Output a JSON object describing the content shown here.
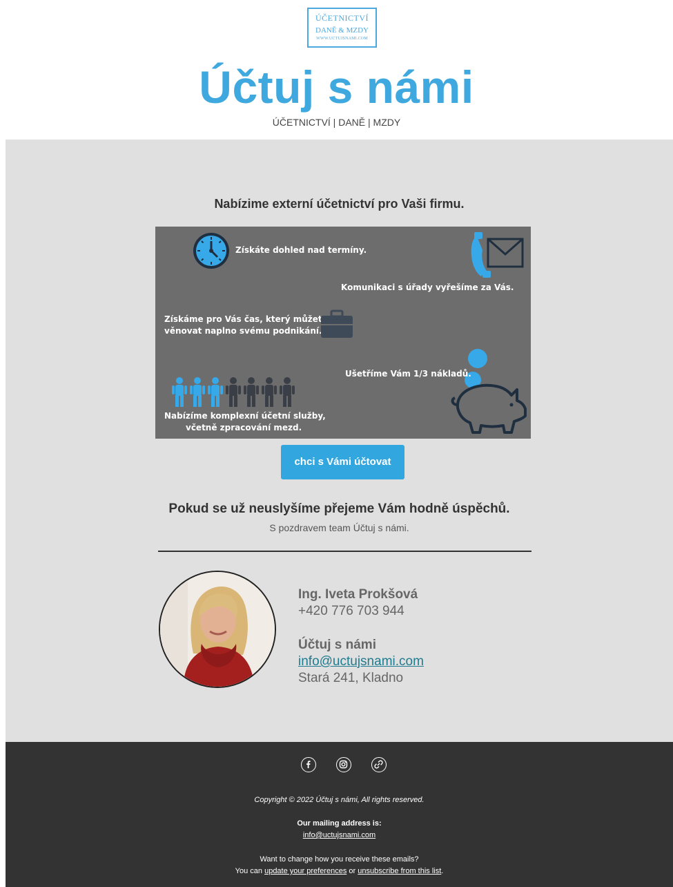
{
  "logo": {
    "line1": "ÚČETNICTVÍ",
    "line2": "DANĚ & MZDY",
    "line3": "WWW.UCTUJSNAMI.COM"
  },
  "header": {
    "brand": "Účtuj s námi",
    "tagline": "ÚČETNICTVÍ | DANĚ | MZDY"
  },
  "main": {
    "headline": "Nabízime externí účetnictví pro Vaši firmu.",
    "infographic": {
      "deadlines": "Získáte dohled nad termíny.",
      "authorities": "Komunikaci s úřady vyřešíme za Vás.",
      "time_line1": "Získáme pro Vás čas, který můžete",
      "time_line2": "věnovat naplno svému podnikání.",
      "savings": "Ušetříme Vám 1/3 nákladů.",
      "services_line1": "Nabízíme komplexní účetní služby,",
      "services_line2": "včetně zpracování mezd.",
      "people_highlighted": 3,
      "people_total": 7,
      "colors": {
        "background": "#6d6d6d",
        "accent": "#37a8e8",
        "dark": "#1f2f3f"
      },
      "icons": [
        "clock-icon",
        "phone-mail-icon",
        "briefcase-icon",
        "people-icon",
        "piggy-bank-icon",
        "coin-icon"
      ]
    },
    "cta_label": "chci s Vámi účtovat",
    "farewell": "Pokud se už neuslyšíme přejeme Vám hodně úspěchů.",
    "regards": "S pozdravem team Účtuj s námi."
  },
  "signature": {
    "name": "Ing. Iveta Prokšová",
    "phone": "+420 776 703 944",
    "company": "Účtuj s námi",
    "email": "info@uctujsnami.com",
    "address": "Stará 241, Kladno"
  },
  "footer": {
    "social_icons": [
      "facebook-icon",
      "instagram-icon",
      "website-link-icon"
    ],
    "copyright": "Copyright © 2022 Účtuj s námi, All rights reserved.",
    "mailing_label": "Our mailing address is:",
    "mailing_email": "info@uctujsnami.com",
    "change_line": "Want to change how you receive these emails?",
    "you_can": "You can",
    "update_prefs": "update your preferences",
    "or": "or",
    "unsubscribe": "unsubscribe from this list"
  },
  "colors": {
    "brand_blue": "#3fa9df",
    "main_bg": "#e0e0e0",
    "footer_bg": "#333333",
    "link_teal": "#1f7b8f"
  }
}
